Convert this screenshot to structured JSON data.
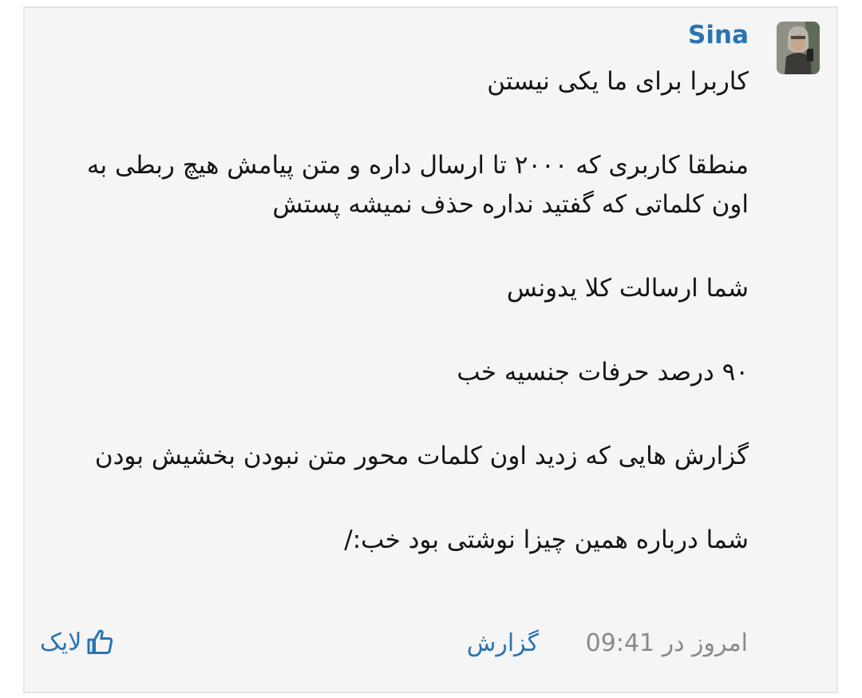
{
  "post": {
    "author": "Sina",
    "paragraphs": [
      "کاربرا برای ما یکی نیستن",
      "منطقا کاربری که ۲۰۰۰ تا ارسال داره و متن پیامش هیچ ربطی به اون کلماتی که گفتید نداره حذف نمیشه پستش",
      "شما ارسالت کلا یدونس",
      "۹۰ درصد حرفات جنسیه خب",
      "گزارش هایی که زدید اون کلمات محور متن نبودن بخشیش بودن",
      "شما درباره همین چیزا نوشتی بود خب:/"
    ],
    "timestamp": "امروز در 09:41",
    "report_label": "گزارش",
    "like_label": "لایک"
  },
  "icons": {
    "avatar": "user-avatar-photo",
    "like": "thumbs-up-icon"
  },
  "colors": {
    "accent": "#2a74b2",
    "text": "#141414",
    "muted": "#8a8a8a",
    "card_bg": "#f5f5f5"
  }
}
